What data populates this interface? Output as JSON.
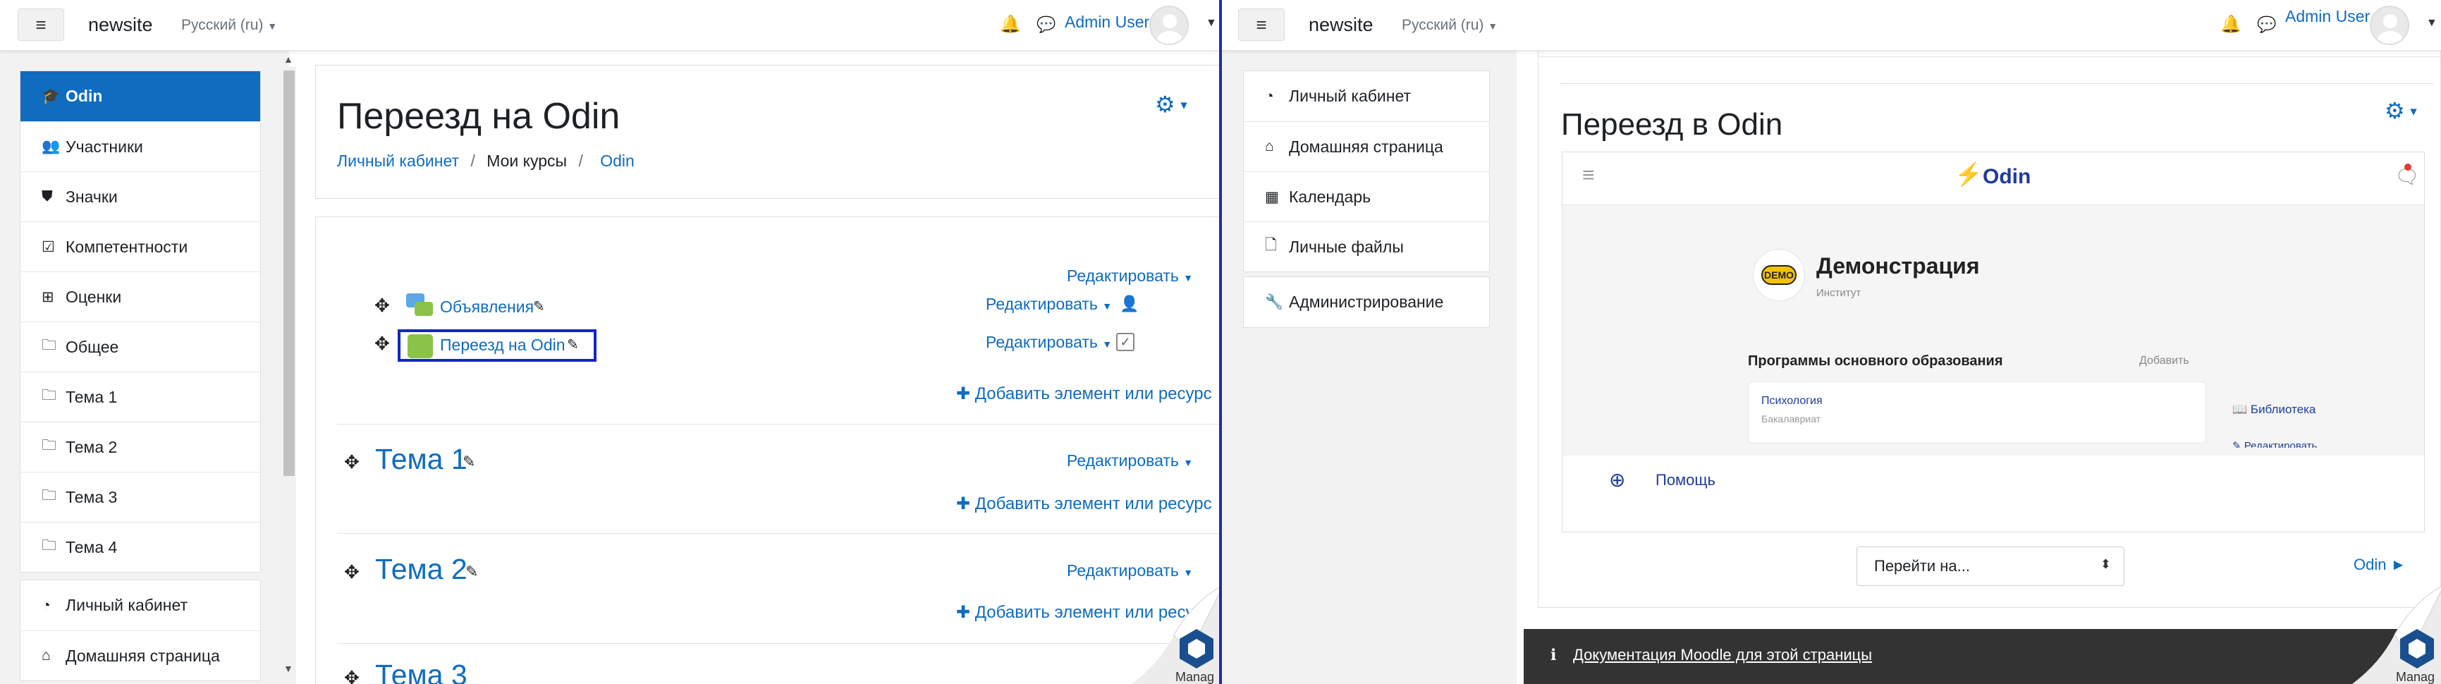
{
  "left": {
    "navbar": {
      "menu_icon": "bars-icon",
      "site_name": "newsite",
      "language": "Русский (ru)",
      "user_name": "Admin User"
    },
    "drawer": {
      "course_items": [
        {
          "icon": "graduation-cap-icon",
          "glyph": "🎓",
          "label": "Odin",
          "active": true
        },
        {
          "icon": "users-icon",
          "glyph": "👥",
          "label": "Участники"
        },
        {
          "icon": "shield-icon",
          "glyph": "⛊",
          "label": "Значки"
        },
        {
          "icon": "check-square-icon",
          "glyph": "☑",
          "label": "Компетентности"
        },
        {
          "icon": "table-icon",
          "glyph": "⊞",
          "label": "Оценки"
        },
        {
          "icon": "folder-icon",
          "glyph": "🗀",
          "label": "Общее"
        },
        {
          "icon": "folder-icon",
          "glyph": "🗀",
          "label": "Тема 1"
        },
        {
          "icon": "folder-icon",
          "glyph": "🗀",
          "label": "Тема 2"
        },
        {
          "icon": "folder-icon",
          "glyph": "🗀",
          "label": "Тема 3"
        },
        {
          "icon": "folder-icon",
          "glyph": "🗀",
          "label": "Тема 4"
        }
      ],
      "site_items": [
        {
          "icon": "dashboard-icon",
          "glyph": "◔",
          "label": "Личный кабинет"
        },
        {
          "icon": "home-icon",
          "glyph": "⌂",
          "label": "Домашняя страница"
        }
      ]
    },
    "header": {
      "title": "Переезд на Odin",
      "breadcrumb": [
        "Личный кабинет",
        "Мои курсы",
        "Odin"
      ]
    },
    "content": {
      "edit_label": "Редактировать",
      "add_label": "Добавить элемент или ресурс",
      "activities": [
        {
          "label": "Объявления",
          "icon": "forum-icon"
        },
        {
          "label": "Переезд на Odin",
          "icon": "puzzle-icon"
        }
      ],
      "sections": [
        "Тема 1",
        "Тема 2",
        "Тема 3"
      ]
    }
  },
  "right": {
    "navbar": {
      "site_name": "newsite",
      "language": "Русский (ru)",
      "user_name": "Admin User"
    },
    "drawer": {
      "items": [
        {
          "icon": "dashboard-icon",
          "glyph": "◔",
          "label": "Личный кабинет"
        },
        {
          "icon": "home-icon",
          "glyph": "⌂",
          "label": "Домашняя страница"
        },
        {
          "icon": "calendar-icon",
          "glyph": "▦",
          "label": "Календарь"
        },
        {
          "icon": "file-icon",
          "glyph": "🗋",
          "label": "Личные файлы"
        }
      ],
      "admin_item": {
        "icon": "wrench-icon",
        "glyph": "🔧",
        "label": "Администрирование"
      }
    },
    "header": {
      "title": "Переезд в Odin"
    },
    "embed": {
      "brand": "Odin",
      "org_badge": "DEMO",
      "org_name": "Демонстрация",
      "org_type": "Институт",
      "programs_title": "Программы основного образования",
      "programs_add": "Добавить",
      "program_name": "Психология",
      "program_level": "Бакалавриат",
      "library_label": "Библиотека",
      "edit_label": "Редактировать",
      "help_label": "Помощь"
    },
    "jump_select": "Перейти на...",
    "next_link": "Odin ►",
    "footer_link": "Документация Moodle для этой страницы",
    "watermark_text": "Manag"
  },
  "colors": {
    "accent": "#0f6cbf",
    "highlight_box": "#1426c4",
    "pane_divider": "#1f2bb0",
    "footer": "#333333"
  }
}
